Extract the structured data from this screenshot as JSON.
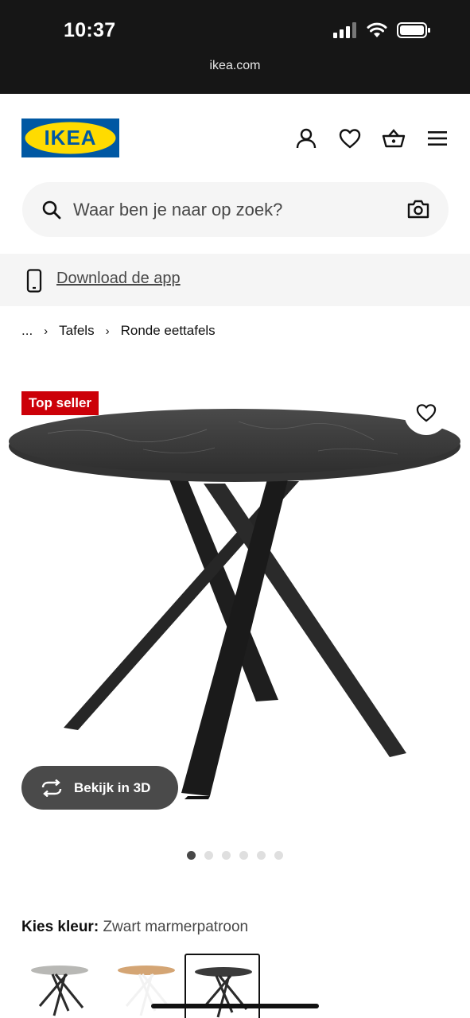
{
  "status_bar": {
    "time": "10:37",
    "url": "ikea.com"
  },
  "header": {
    "logo_text": "IKEA",
    "icons": [
      "account-icon",
      "heart-icon",
      "basket-icon",
      "menu-icon"
    ]
  },
  "search": {
    "placeholder": "Waar ben je naar op zoek?"
  },
  "app_banner": {
    "link": "Download de app"
  },
  "breadcrumb": {
    "items": [
      "...",
      "Tafels",
      "Ronde eettafels"
    ]
  },
  "product": {
    "badge": "Top seller",
    "view_3d_label": "Bekijk in 3D",
    "image_count": 6,
    "active_image": 1
  },
  "color": {
    "label": "Kies kleur:",
    "value": "Zwart marmerpatroon",
    "options": [
      {
        "top": "#b8b8b5",
        "legs": "#2b2b2b"
      },
      {
        "top": "#d4a574",
        "legs": "#f2f2f2"
      },
      {
        "top": "#3a3a3a",
        "legs": "#2b2b2b",
        "selected": true
      }
    ]
  },
  "colors": {
    "ikea_blue": "#0058a3",
    "ikea_yellow": "#ffdb00",
    "badge_red": "#cc0008"
  }
}
